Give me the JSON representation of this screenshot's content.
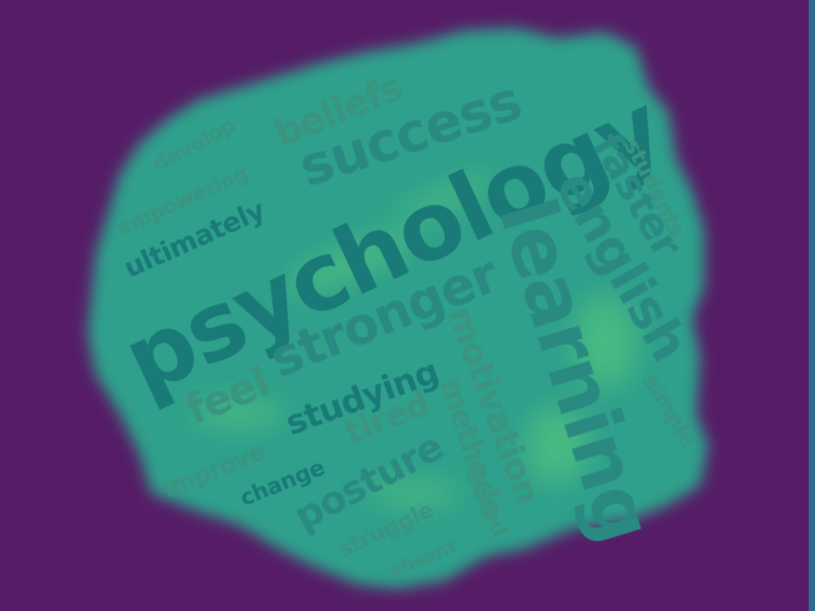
{
  "colors": {
    "background": "#561d66",
    "edge": "#2f6b8c",
    "blob": "#2fa08c",
    "blob_glow": "#5ecf7a",
    "word_dark": "#1a7a78",
    "word_mid": "#2a8a82",
    "word_light": "#3a9480"
  },
  "words": [
    {
      "id": "psychology",
      "text": "psychology"
    },
    {
      "id": "learning",
      "text": "learning"
    },
    {
      "id": "success",
      "text": "success"
    },
    {
      "id": "english",
      "text": "english"
    },
    {
      "id": "stronger",
      "text": "stronger"
    },
    {
      "id": "faster",
      "text": "faster"
    },
    {
      "id": "beliefs",
      "text": "beliefs"
    },
    {
      "id": "feel",
      "text": "feel"
    },
    {
      "id": "ultimately",
      "text": "ultimately"
    },
    {
      "id": "motivation",
      "text": "motivation"
    },
    {
      "id": "studying",
      "text": "studying"
    },
    {
      "id": "posture",
      "text": "posture"
    },
    {
      "id": "methods",
      "text": "methods"
    },
    {
      "id": "tired",
      "text": "tired"
    },
    {
      "id": "empowering",
      "text": "empowering"
    },
    {
      "id": "develop",
      "text": "develop"
    },
    {
      "id": "students",
      "text": "students"
    },
    {
      "id": "simple",
      "text": "simple"
    },
    {
      "id": "improve",
      "text": "improve"
    },
    {
      "id": "change",
      "text": "change"
    },
    {
      "id": "struggle",
      "text": "struggle"
    },
    {
      "id": "bored",
      "text": "bored"
    },
    {
      "id": "absent",
      "text": "absent"
    }
  ]
}
